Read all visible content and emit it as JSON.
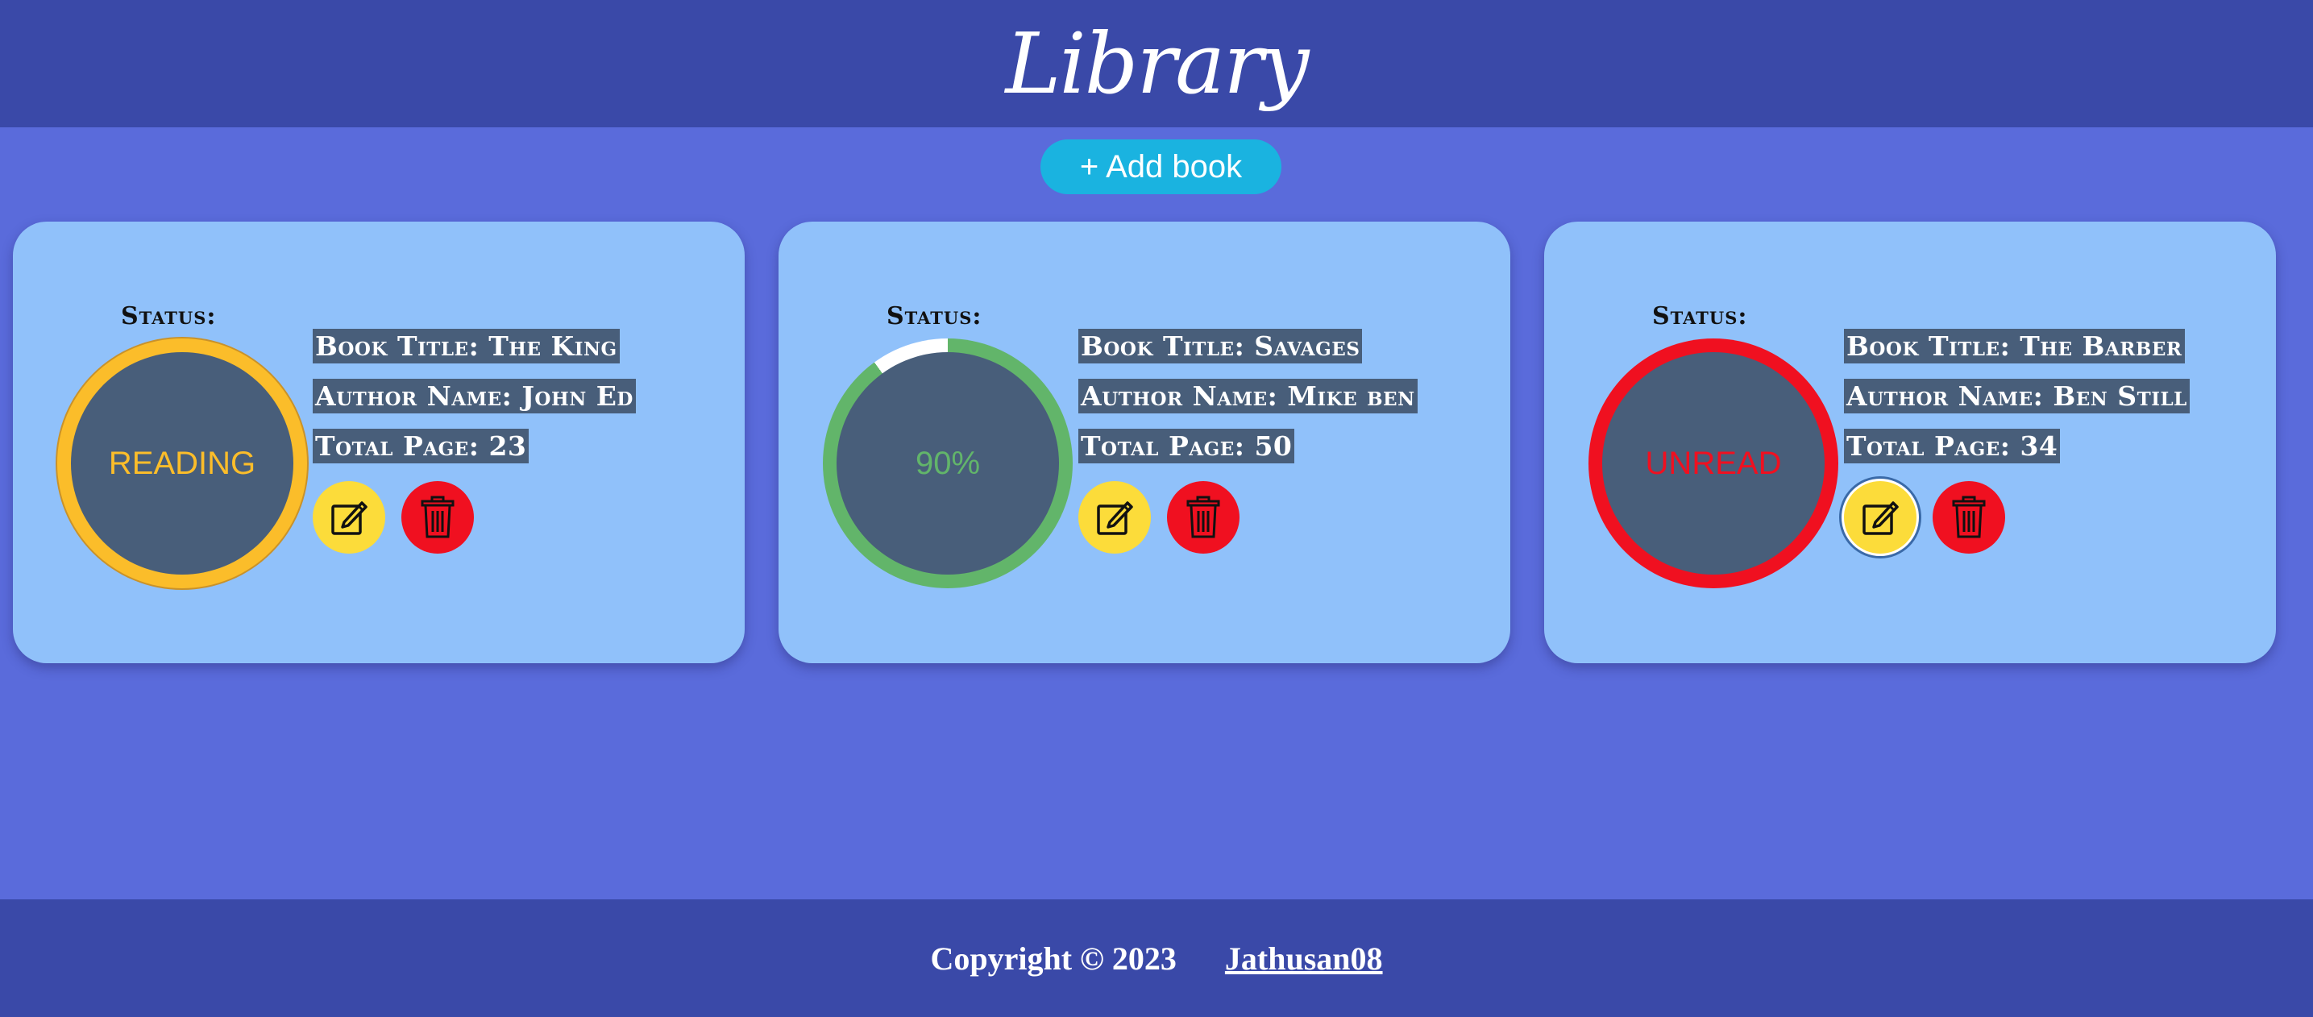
{
  "header": {
    "title": "Library"
  },
  "add_button": {
    "label": "+ Add book"
  },
  "colors": {
    "reading": "#fbbd2a",
    "progress": "#62b56a",
    "unread": "#f01020"
  },
  "books": [
    {
      "status_label": "Status:",
      "status_text": "READING",
      "title_line": "Book Title: The King",
      "author_line": "Author Name: John Ed",
      "pages_line": "Total Page: 23"
    },
    {
      "status_label": "Status:",
      "status_text": "90%",
      "progress": 0.9,
      "title_line": "Book Title: Savages",
      "author_line": "Author Name: Mike ben",
      "pages_line": "Total Page: 50"
    },
    {
      "status_label": "Status:",
      "status_text": "UNREAD",
      "title_line": "Book Title: The Barber",
      "author_line": "Author Name: Ben Still",
      "pages_line": "Total Page: 34"
    }
  ],
  "icons": {
    "edit": "edit-icon",
    "delete": "trash-icon"
  },
  "footer": {
    "copyright": "Copyright © 2023",
    "author_link": "Jathusan08"
  }
}
